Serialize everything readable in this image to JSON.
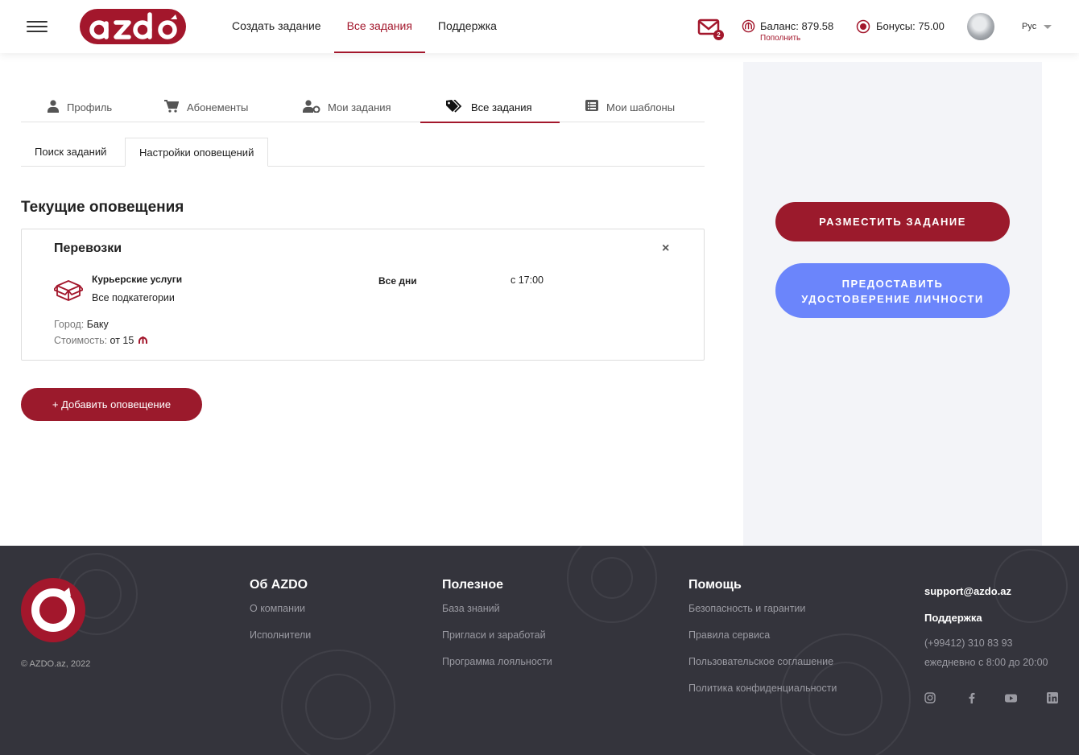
{
  "header": {
    "nav": [
      "Создать задание",
      "Все задания",
      "Поддержка"
    ],
    "mail_badge": "2",
    "balance": "Баланс: 879.58",
    "topup": "Пополнить",
    "bonus": "Бонусы: 75.00",
    "lang": "Рус",
    "logo_text": "azdo",
    "brand_color": "#a3172c"
  },
  "tabs": [
    "Профиль",
    "Абонементы",
    "Мои задания",
    "Все задания",
    "Мои шаблоны"
  ],
  "subtabs": [
    "Поиск заданий",
    "Настройки оповещений"
  ],
  "section_title": "Текущие оповещения",
  "notification": {
    "title": "Перевозки",
    "close": "×",
    "category": "Курьерские услуги",
    "subcategory": "Все подкатегории",
    "days": "Все дни",
    "time": "с 17:00",
    "city_label": "Город: ",
    "city": "Баку",
    "cost_label": "Стоимость: ",
    "cost": "от 15",
    "currency_icon": "manat-icon"
  },
  "add_button": "+ Добавить оповещение",
  "sidebar": {
    "post_task": "РАЗМЕСТИТЬ ЗАДАНИЕ",
    "verify_id": "ПРЕДОСТАВИТЬ УДОСТОВЕРЕНИЕ ЛИЧНОСТИ",
    "accent_blue": "#6b85fb"
  },
  "footer": {
    "copyright": "© AZDO.az, 2022",
    "col1": {
      "title": "Об AZDO",
      "links": [
        "О компании",
        "Исполнители"
      ]
    },
    "col2": {
      "title": "Полезное",
      "links": [
        "База знаний",
        "Пригласи и заработай",
        "Программа лояльности"
      ]
    },
    "col3": {
      "title": "Помощь",
      "links": [
        "Безопасность и гарантии",
        "Правила сервиса",
        "Пользовательское соглашение",
        "Политика конфиденциальности"
      ]
    },
    "email": "support@azdo.az",
    "support": "Поддержка",
    "phone": "(+99412) 310 83 93",
    "hours": "ежедневно с 8:00 до 20:00",
    "socials": [
      "instagram-icon",
      "facebook-icon",
      "youtube-icon",
      "linkedin-icon"
    ]
  }
}
